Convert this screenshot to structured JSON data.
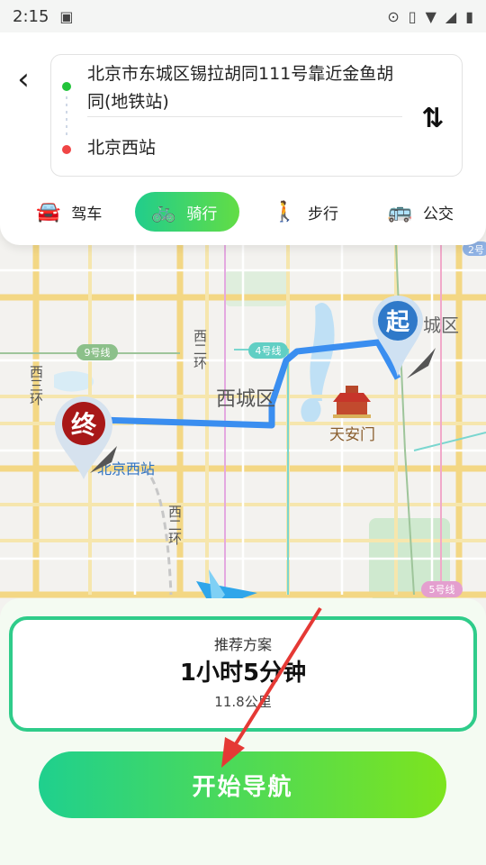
{
  "status_bar": {
    "time": "2:15"
  },
  "route": {
    "origin": "北京市东城区锡拉胡同111号靠近金鱼胡同(地铁站)",
    "destination": "北京西站"
  },
  "modes": [
    {
      "label": "驾车",
      "icon": "car-icon",
      "active": false
    },
    {
      "label": "骑行",
      "icon": "bicycle-icon",
      "active": true
    },
    {
      "label": "步行",
      "icon": "walk-icon",
      "active": false
    },
    {
      "label": "公交",
      "icon": "bus-icon",
      "active": false
    }
  ],
  "map": {
    "labels": {
      "xi_er_huan_top": "西二环",
      "xi_san_huan": "西三环",
      "xicheng": "西城区",
      "tiananmen": "天安门",
      "beijing_west": "北京西站",
      "xi_er_huan_bottom": "西二环",
      "line9": "9号线",
      "line4": "4号线",
      "line5": "5号线",
      "line2": "2号",
      "district_right": "城区"
    },
    "markers": {
      "start": "起",
      "end": "终"
    },
    "colors": {
      "route": "#3a8ef0",
      "start_marker": "#2f79c9",
      "end_marker": "#a81818"
    }
  },
  "plan": {
    "label": "推荐方案",
    "duration": "1小时5分钟",
    "distance": "11.8公里"
  },
  "start_button": "开始导航",
  "colors": {
    "accent_start": "#1fd08e",
    "accent_end": "#7de41e",
    "annotation": "#e53935"
  }
}
